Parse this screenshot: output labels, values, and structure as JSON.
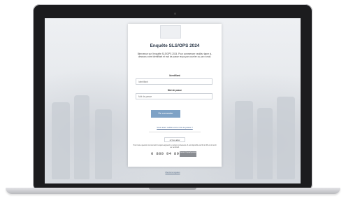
{
  "survey": {
    "title": "Enquête SLS/OPS 2024",
    "intro": "Bienvenue sur l'enquête SLS/OPS 2024. Pour commencer veuillez taper ci-dessous votre identifiant et mot de passe reçus par courrier ou par e-mail.",
    "identifier_label": "Identifiant",
    "identifier_placeholder": "Identifiant",
    "password_label": "Mot de passe",
    "password_placeholder": "Mot de passe",
    "login_button": "Se connecter",
    "forgot_link": "Vous avez oublié votre mot de passe ?",
    "help_button": "Vous aider",
    "help_text": "Pour toute question concernant l'enquête appelez le numéro ci-dessous. Il est disponible de 9h à 19h et du lundi au vendredi.",
    "phone_number": "0 800 94 89 99",
    "phone_badge": "Service & appel gratuits"
  },
  "footer": {
    "link": "Mentions légales"
  }
}
